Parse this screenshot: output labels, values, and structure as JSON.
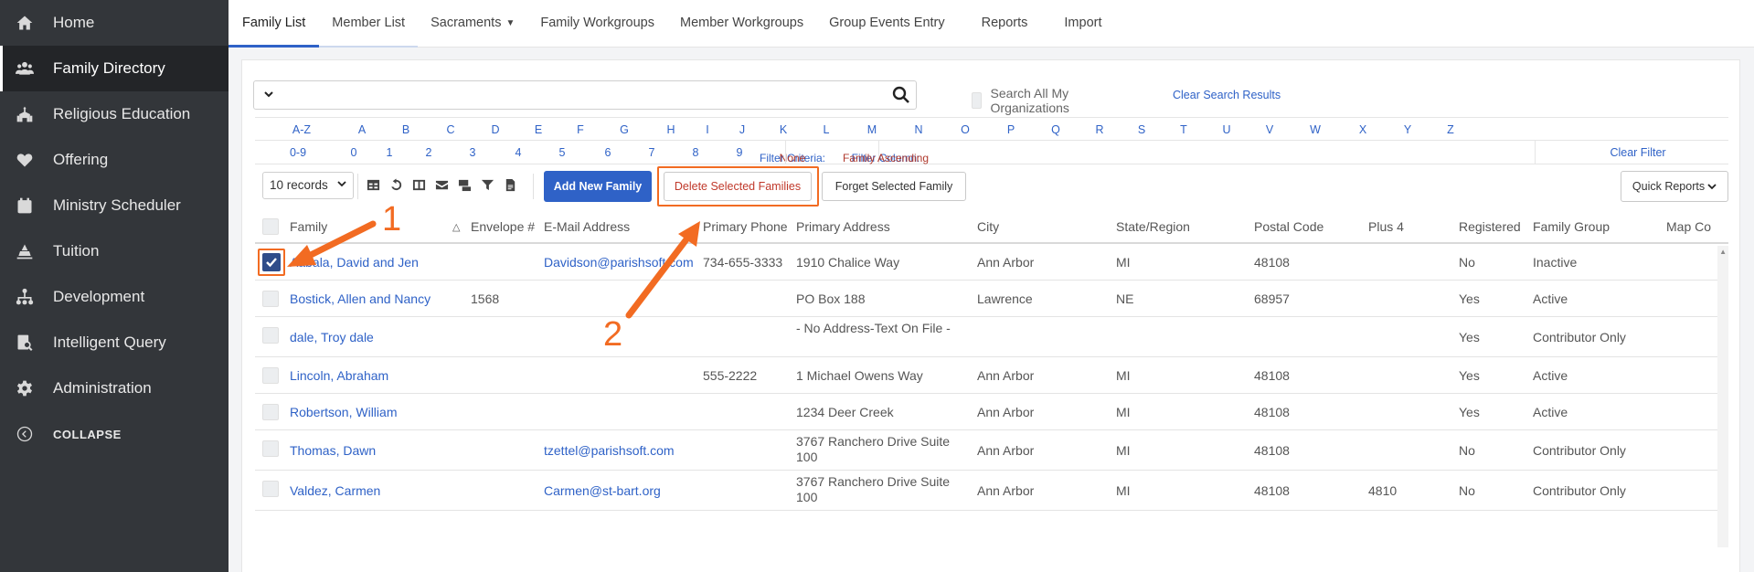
{
  "sidebar": {
    "items": [
      {
        "label": "Home",
        "icon": "home-icon"
      },
      {
        "label": "Family Directory",
        "icon": "users-icon"
      },
      {
        "label": "Religious Education",
        "icon": "education-icon"
      },
      {
        "label": "Offering",
        "icon": "heart-icon"
      },
      {
        "label": "Ministry Scheduler",
        "icon": "calendar-icon"
      },
      {
        "label": "Tuition",
        "icon": "tuition-icon"
      },
      {
        "label": "Development",
        "icon": "sitemap-icon"
      },
      {
        "label": "Intelligent Query",
        "icon": "query-icon"
      },
      {
        "label": "Administration",
        "icon": "gear-icon"
      }
    ],
    "collapse_label": "COLLAPSE"
  },
  "tabs": [
    {
      "label": "Family List"
    },
    {
      "label": "Member List"
    },
    {
      "label": "Sacraments"
    },
    {
      "label": "Family Workgroups"
    },
    {
      "label": "Member Workgroups"
    },
    {
      "label": "Group Events Entry"
    },
    {
      "label": "Reports"
    },
    {
      "label": "Import"
    }
  ],
  "search": {
    "value": "",
    "all_orgs_label": "Search All My Organizations",
    "clear_label": "Clear Search Results"
  },
  "alpha_row": [
    "A-Z",
    "A",
    "B",
    "C",
    "D",
    "E",
    "F",
    "G",
    "H",
    "I",
    "J",
    "K",
    "L",
    "M",
    "N",
    "O",
    "P",
    "Q",
    "R",
    "S",
    "T",
    "U",
    "V",
    "W",
    "X",
    "Y",
    "Z"
  ],
  "num_row": [
    "0-9",
    "0",
    "1",
    "2",
    "3",
    "4",
    "5",
    "6",
    "7",
    "8",
    "9"
  ],
  "filter": {
    "criteria_label": "Filter Criteria:",
    "criteria_value": "None",
    "column_label": "Filter Column:",
    "column_value": "Family Ascending",
    "clear_label": "Clear Filter"
  },
  "toolbar": {
    "records": "10 records",
    "add_label": "Add New Family",
    "delete_label": "Delete Selected Families",
    "forget_label": "Forget Selected Family",
    "quick_label": "Quick Reports"
  },
  "columns": [
    "Family",
    "Envelope #",
    "E-Mail Address",
    "Primary Phone",
    "Primary Address",
    "City",
    "State/Region",
    "Postal Code",
    "Plus 4",
    "Registered",
    "Family Group",
    "Map Co"
  ],
  "rows": [
    {
      "family": "Aabala, David and Jen",
      "envelope": "",
      "email": "Davidson@parishsoft.com",
      "phone": "734-655-3333",
      "address": "1910 Chalice Way",
      "city": "Ann Arbor",
      "state": "MI",
      "postal": "48108",
      "plus4": "",
      "registered": "No",
      "group": "Inactive",
      "checked": true
    },
    {
      "family": "Bostick, Allen and Nancy",
      "envelope": "1568",
      "email": "",
      "phone": "",
      "address": "PO Box 188",
      "city": "Lawrence",
      "state": "NE",
      "postal": "68957",
      "plus4": "",
      "registered": "Yes",
      "group": "Active",
      "checked": false
    },
    {
      "family": "dale, Troy dale",
      "envelope": "",
      "email": "",
      "phone": "",
      "address": "- No Address-Text On File -",
      "city": "",
      "state": "",
      "postal": "",
      "plus4": "",
      "registered": "Yes",
      "group": "Contributor Only",
      "checked": false
    },
    {
      "family": "Lincoln, Abraham",
      "envelope": "",
      "email": "",
      "phone": "555-2222",
      "address": "1 Michael Owens Way",
      "city": "Ann Arbor",
      "state": "MI",
      "postal": "48108",
      "plus4": "",
      "registered": "Yes",
      "group": "Active",
      "checked": false
    },
    {
      "family": "Robertson, William",
      "envelope": "",
      "email": "",
      "phone": "",
      "address": "1234 Deer Creek",
      "city": "Ann Arbor",
      "state": "MI",
      "postal": "48108",
      "plus4": "",
      "registered": "Yes",
      "group": "Active",
      "checked": false
    },
    {
      "family": "Thomas, Dawn",
      "envelope": "",
      "email": "tzettel@parishsoft.com",
      "phone": "",
      "address": "3767 Ranchero Drive Suite 100",
      "city": "Ann Arbor",
      "state": "MI",
      "postal": "48108",
      "plus4": "",
      "registered": "No",
      "group": "Contributor Only",
      "checked": false
    },
    {
      "family": "Valdez, Carmen",
      "envelope": "",
      "email": "Carmen@st-bart.org",
      "phone": "",
      "address": "3767 Ranchero Drive Suite 100",
      "city": "Ann Arbor",
      "state": "MI",
      "postal": "48108",
      "plus4": "4810",
      "registered": "No",
      "group": "Contributor Only",
      "checked": false
    }
  ],
  "annotations": {
    "step1": "1",
    "step2": "2"
  },
  "colors": {
    "accent": "#2f62c7",
    "sidebar": "#33363a",
    "annotation": "#f26b22",
    "danger": "#c0392b"
  }
}
